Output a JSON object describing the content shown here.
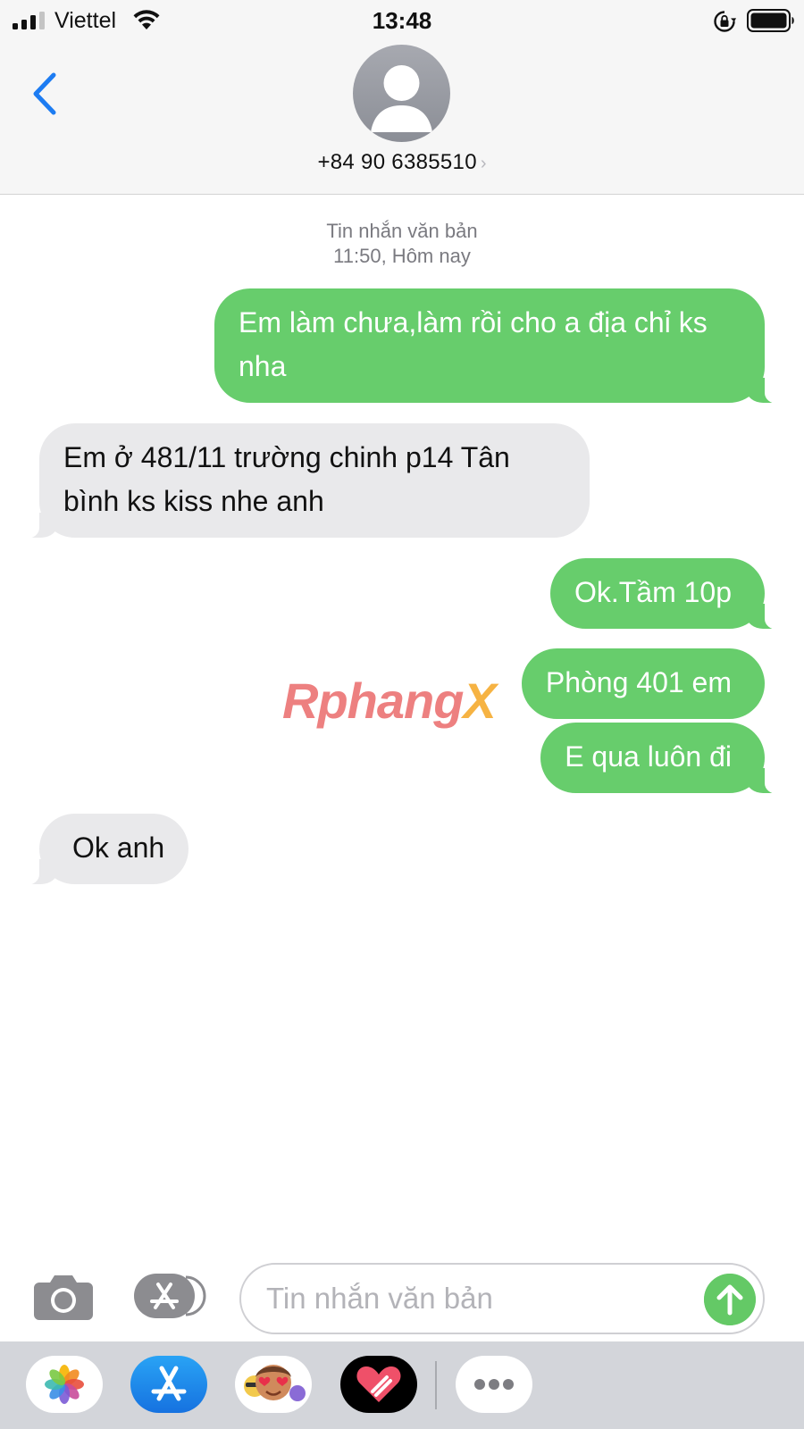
{
  "status_bar": {
    "carrier": "Viettel",
    "time": "13:48"
  },
  "header": {
    "contact": "+84 90 6385510",
    "contact_chevron": "›"
  },
  "conversation": {
    "timestamp_type": "Tin nhắn văn bản",
    "timestamp_time": "11:50, Hôm nay",
    "messages": [
      {
        "direction": "sent",
        "text": "Em làm chưa,làm rồi cho a địa chỉ ks nha"
      },
      {
        "direction": "received",
        "text": "Em ở 481/11 trường chinh p14 Tân bình ks kiss nhe anh"
      },
      {
        "direction": "sent",
        "text": "Ok.Tầm 10p"
      },
      {
        "direction": "sent",
        "text": "Phòng 401 em"
      },
      {
        "direction": "sent",
        "text": "E qua luôn đi"
      },
      {
        "direction": "received",
        "text": "Ok anh"
      }
    ]
  },
  "watermark": {
    "part1": "Rphang",
    "part2": "X"
  },
  "composer": {
    "placeholder": "Tin nhắn văn bản",
    "value": ""
  },
  "app_drawer": {
    "apps": [
      "photos-icon",
      "app-store-icon",
      "memoji-icon",
      "digital-touch-icon",
      "more-icon"
    ]
  },
  "colors": {
    "sent_bubble": "#67cd6c",
    "received_bubble": "#e9e9eb",
    "accent_blue": "#1d7cf2",
    "send_button": "#64c966"
  }
}
